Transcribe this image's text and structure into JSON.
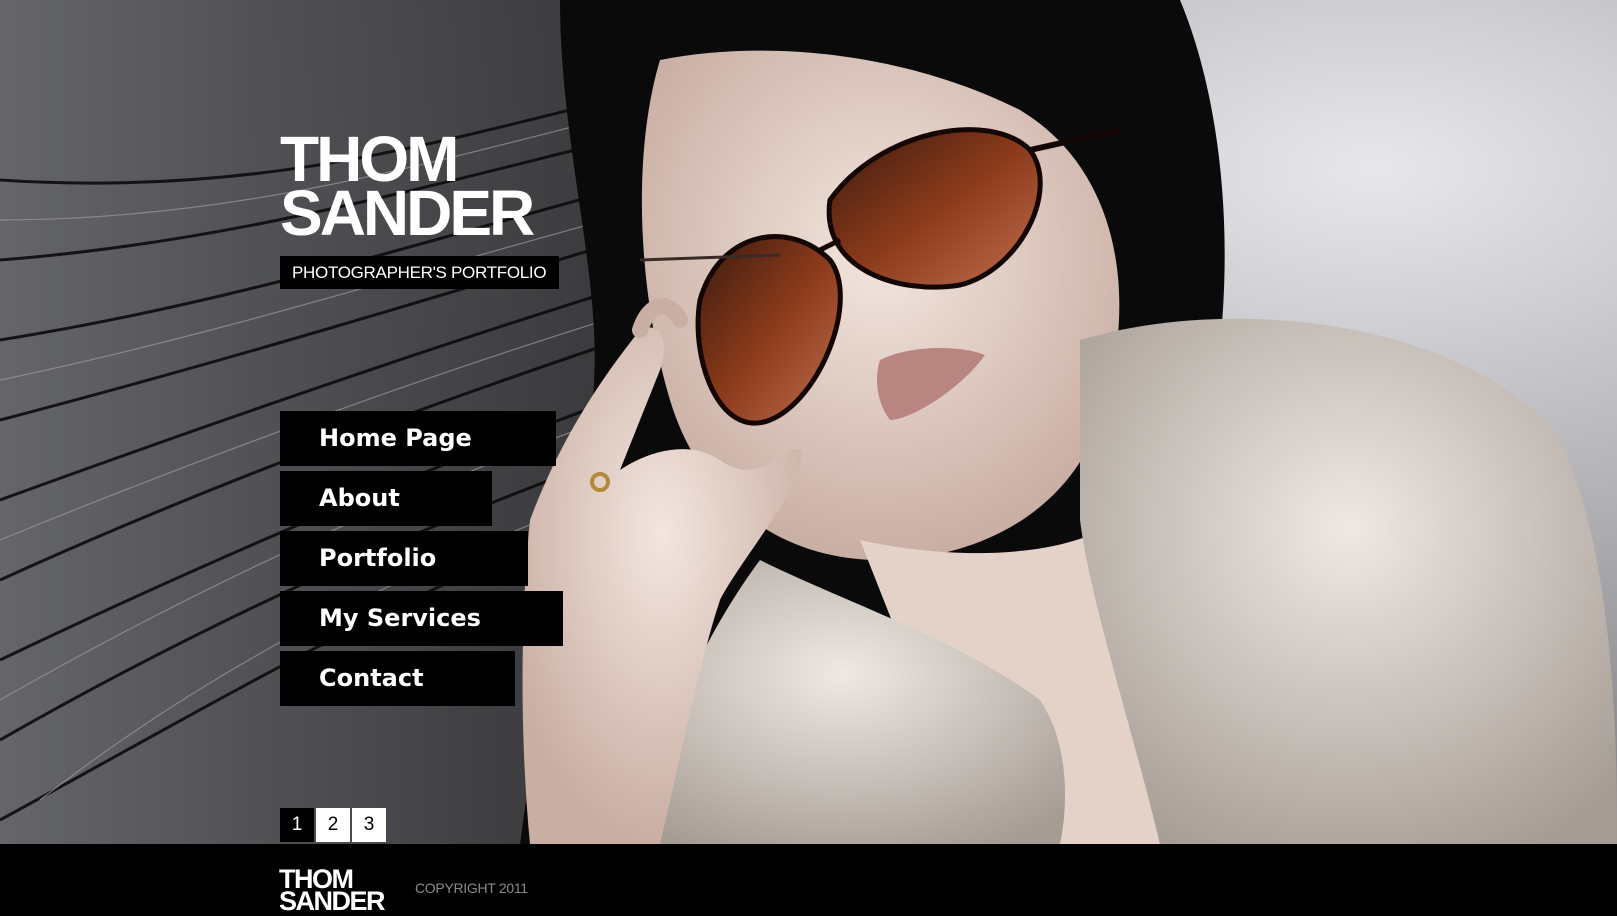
{
  "logo": {
    "line1": "THOM",
    "line2": "SANDER",
    "tagline": "PHOTOGRAPHER'S PORTFOLIO"
  },
  "nav": {
    "items": [
      {
        "label": "Home Page"
      },
      {
        "label": "About"
      },
      {
        "label": "Portfolio"
      },
      {
        "label": "My Services"
      },
      {
        "label": "Contact"
      }
    ]
  },
  "pager": {
    "pages": [
      "1",
      "2",
      "3"
    ],
    "active": "1"
  },
  "footer": {
    "logo_line1": "THOM",
    "logo_line2": "SANDER",
    "copyright": "COPYRIGHT 2011"
  },
  "colors": {
    "nav_bg": "#000000",
    "nav_text": "#ffffff",
    "footer_bg": "#000000",
    "copyright_text": "#8a8a8a"
  }
}
